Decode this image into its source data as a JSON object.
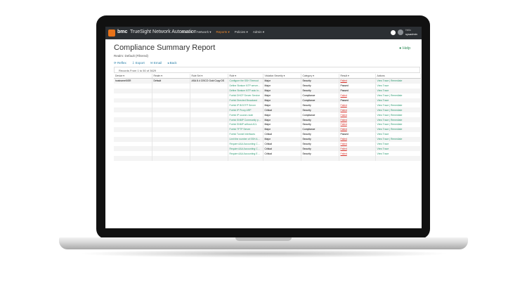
{
  "nav": {
    "brand": "bmc",
    "product": "TrueSight Network Automation",
    "menu": [
      {
        "label": "Home ▾",
        "active": false
      },
      {
        "label": "Network ▾",
        "active": false
      },
      {
        "label": "Reports ▾",
        "active": true
      },
      {
        "label": "Policies ▾",
        "active": false
      },
      {
        "label": "Admin ▾",
        "active": false
      }
    ],
    "user_caption": "Hello",
    "user_name": "sysadmin"
  },
  "page": {
    "title": "Compliance Summary Report",
    "help": "Help",
    "realm": "Realm: Default (Filtered)"
  },
  "toolbar": {
    "refresh": "⟳ Reflex",
    "export": "⇩ Export",
    "email": "✉ Email",
    "back": "◂ Back"
  },
  "records_text": "Records From 1 to 50 of 3629",
  "table": {
    "headers": [
      "Device ▾",
      "Realm ▾",
      "Rule Set ▾",
      "Rule ▾",
      "Violation Severity ▾",
      "Category ▾",
      "Result ▾",
      "Actions"
    ],
    "rows": [
      {
        "device": "hostname5ISR",
        "realm": "Default",
        "ruleset": "ASA 8.4 CISCO Gold Copy DS",
        "rule": "Configure the SSH Timeout",
        "severity": "Major",
        "category": "Security",
        "result": "Failed",
        "actions": "View Trace | Remediate"
      },
      {
        "device": "",
        "realm": "",
        "ruleset": "",
        "rule": "Define Stratum NTP servers assigned",
        "severity": "Major",
        "category": "Security",
        "result": "Passed",
        "actions": "View Trace"
      },
      {
        "device": "",
        "realm": "",
        "ruleset": "",
        "rule": "Define Stratum NTP auto Integrate",
        "severity": "Major",
        "category": "Security",
        "result": "Passed",
        "actions": "View Trace"
      },
      {
        "device": "",
        "realm": "",
        "ruleset": "",
        "rule": "Forbid DHCP Server Service",
        "severity": "Major",
        "category": "Compliance",
        "result": "Failed",
        "actions": "View Trace | Remediate"
      },
      {
        "device": "",
        "realm": "",
        "ruleset": "",
        "rule": "Forbid Directed Broadcast",
        "severity": "Major",
        "category": "Compliance",
        "result": "Passed",
        "actions": "View Trace"
      },
      {
        "device": "",
        "realm": "",
        "ruleset": "",
        "rule": "Forbid IP BOOTP Server",
        "severity": "Major",
        "category": "Security",
        "result": "Failed",
        "actions": "View Trace | Remediate"
      },
      {
        "device": "",
        "realm": "",
        "ruleset": "",
        "rule": "Forbid IP Proxy ARP",
        "severity": "Critical",
        "category": "Security",
        "result": "Failed",
        "actions": "View Trace | Remediate"
      },
      {
        "device": "",
        "realm": "",
        "ruleset": "",
        "rule": "Forbid IP source-route",
        "severity": "Major",
        "category": "Compliance",
        "result": "Failed",
        "actions": "View Trace | Remediate"
      },
      {
        "device": "",
        "realm": "",
        "ruleset": "",
        "rule": "Forbid SNMP Community private/public",
        "severity": "Major",
        "category": "Security",
        "result": "Failed",
        "actions": "View Trace | Remediate"
      },
      {
        "device": "",
        "realm": "",
        "ruleset": "",
        "rule": "Forbid SNMP without ACL",
        "severity": "Major",
        "category": "Security",
        "result": "Failed",
        "actions": "View Trace | Remediate"
      },
      {
        "device": "",
        "realm": "",
        "ruleset": "",
        "rule": "Forbid TFTP Server",
        "severity": "Major",
        "category": "Compliance",
        "result": "Failed",
        "actions": "View Trace | Remediate"
      },
      {
        "device": "",
        "realm": "",
        "ruleset": "",
        "rule": "Forbid Tunnel Interfaces",
        "severity": "Critical",
        "category": "Security",
        "result": "Passed",
        "actions": "View Trace"
      },
      {
        "device": "",
        "realm": "",
        "ruleset": "",
        "rule": "Limit the number of SSH Auth Tries",
        "severity": "Major",
        "category": "Security",
        "result": "Failed",
        "actions": "View Trace | Remediate"
      },
      {
        "device": "",
        "realm": "",
        "ruleset": "",
        "rule": "Require AAA Accounting Connection",
        "severity": "Critical",
        "category": "Security",
        "result": "Failed",
        "actions": "View Trace"
      },
      {
        "device": "",
        "realm": "",
        "ruleset": "",
        "rule": "Require AAA Accounting Commands",
        "severity": "Critical",
        "category": "Security",
        "result": "Failed",
        "actions": "View Trace"
      },
      {
        "device": "",
        "realm": "",
        "ruleset": "",
        "rule": "Require AAA Accounting Exec",
        "severity": "Critical",
        "category": "Security",
        "result": "Failed",
        "actions": "View Trace"
      },
      {
        "device": "",
        "realm": "",
        "ruleset": "",
        "rule": "",
        "severity": "",
        "category": "",
        "result": "",
        "actions": ""
      }
    ]
  },
  "colors": {
    "nav_bg": "#2b2f33",
    "brand_orange": "#e8731a",
    "link_green": "#2e9a72",
    "fail_red": "#d9312a"
  }
}
